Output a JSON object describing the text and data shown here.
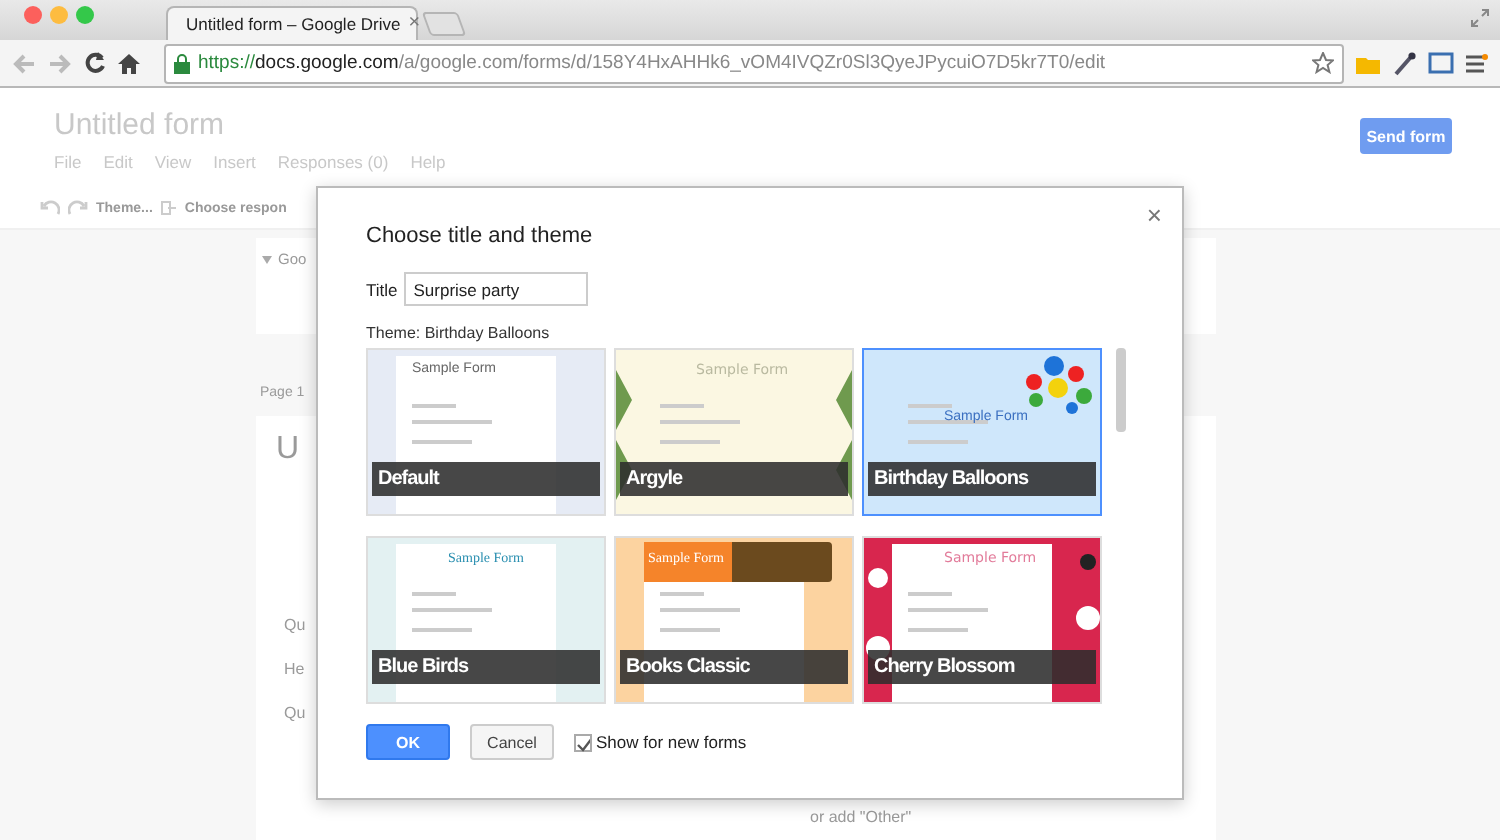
{
  "browser": {
    "tab_title": "Untitled form – Google Drive",
    "tab_close": "×",
    "url": {
      "scheme": "https://",
      "host": "docs.google.com",
      "path": "/a/google.com/forms/d/158Y4HxAHHk6_vOM4IVQZr0Sl3QyeJPycuiO7D5kr7T0/edit"
    }
  },
  "page": {
    "title": "Untitled form",
    "menu": [
      "File",
      "Edit",
      "View",
      "Insert",
      "Responses (0)",
      "Help"
    ],
    "send_button": "Send form",
    "toolbar": {
      "theme": "Theme...",
      "responses": "Choose respon"
    },
    "section": "Goo",
    "page_label": "Page 1",
    "form_title": "U",
    "questions": [
      "Qu",
      "He",
      "Qu"
    ],
    "option_hint": "or add \"Other\""
  },
  "dialog": {
    "title": "Choose title and theme",
    "close": "×",
    "title_label": "Title",
    "title_value": "Surprise party",
    "theme_label": "Theme: Birthday Balloons",
    "themes": [
      {
        "name": "Default",
        "sample_title": "Sample Form",
        "selected": false
      },
      {
        "name": "Argyle",
        "sample_title": "Sample Form",
        "selected": false
      },
      {
        "name": "Birthday Balloons",
        "sample_title": "Sample Form",
        "selected": true
      },
      {
        "name": "Blue Birds",
        "sample_title": "Sample Form",
        "selected": false
      },
      {
        "name": "Books Classic",
        "sample_title": "Sample Form",
        "selected": false
      },
      {
        "name": "Cherry Blossom",
        "sample_title": "Sample Form",
        "selected": false
      }
    ],
    "ok": "OK",
    "cancel": "Cancel",
    "show_for_new": {
      "label": "Show for new forms",
      "checked": true
    }
  }
}
